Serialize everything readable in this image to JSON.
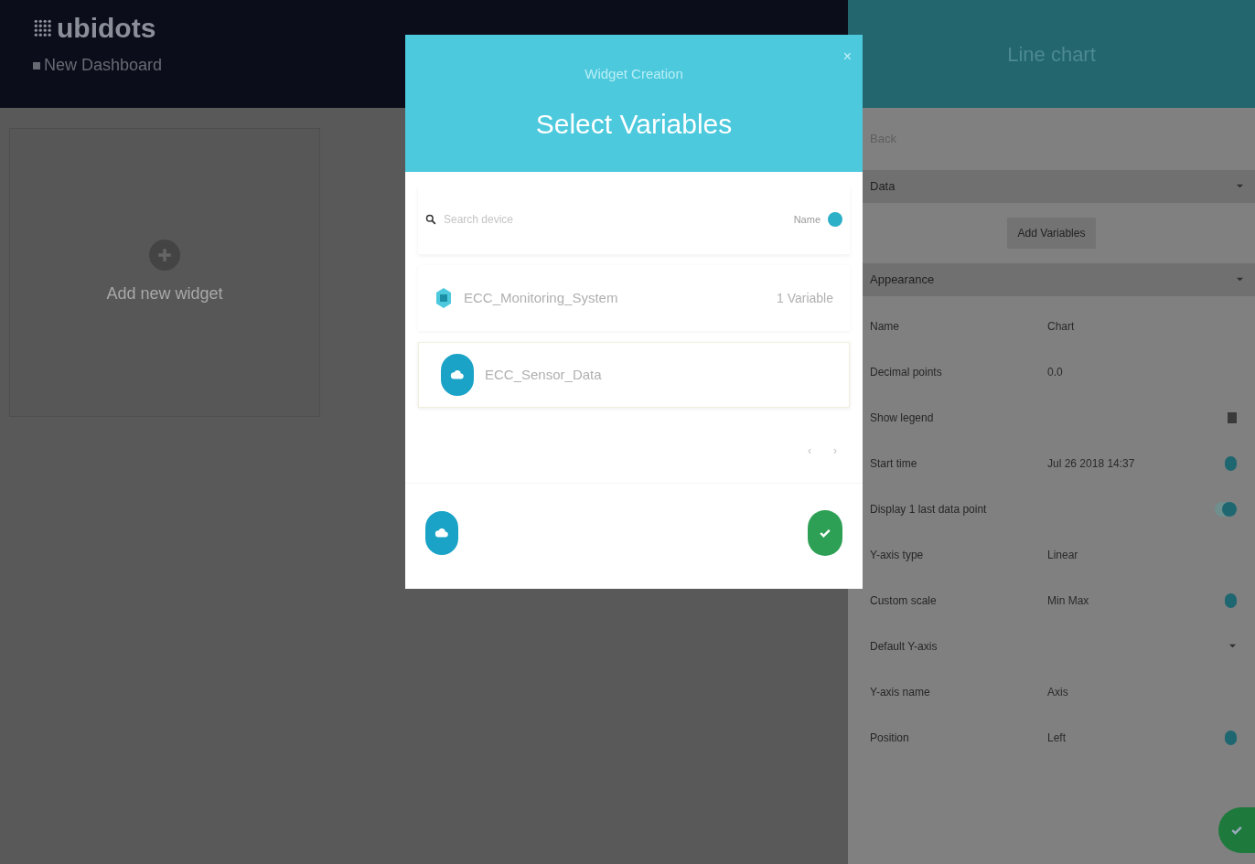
{
  "header": {
    "logo": "ubidots",
    "dashboard": "New Dashboard"
  },
  "canvas": {
    "add_widget": "Add new widget"
  },
  "modal": {
    "subtitle": "Widget Creation",
    "title": "Select Variables",
    "close": "×",
    "search": {
      "placeholder": "Search device"
    },
    "sort_label": "Name",
    "devices": [
      {
        "name": "ECC_Monitoring_System",
        "count": "1 Variable",
        "kind": "chip",
        "selected": false
      },
      {
        "name": "ECC_Sensor_Data",
        "kind": "cloud",
        "selected": true
      }
    ],
    "pager": [
      "‹",
      "›"
    ]
  },
  "panel": {
    "title": "Line chart",
    "back": "Back",
    "data_section": "Data",
    "add_button": "Add Variables",
    "appearance_section": "Appearance",
    "rows": [
      {
        "kind": "value",
        "label": "Name",
        "value": "Chart",
        "info": false
      },
      {
        "kind": "value",
        "label": "Decimal points",
        "value": "0.0",
        "info": false
      },
      {
        "kind": "toggle",
        "label": "Show legend",
        "on": false
      },
      {
        "kind": "value",
        "label": "Start time",
        "value": "Jul 26 2018 14:37",
        "info": true
      },
      {
        "kind": "toggle",
        "label": "Display 1 last data point",
        "on": true
      },
      {
        "kind": "value",
        "label": "Y-axis type",
        "value": "Linear",
        "info": false
      },
      {
        "kind": "value",
        "label": "Custom scale",
        "value": "Min Max",
        "info": true
      },
      {
        "kind": "dropdown",
        "label": "Default Y-axis"
      },
      {
        "kind": "value",
        "label": "Y-axis name",
        "value": "Axis",
        "info": false
      },
      {
        "kind": "value",
        "label": "Position",
        "value": "Left",
        "info": true
      }
    ]
  }
}
